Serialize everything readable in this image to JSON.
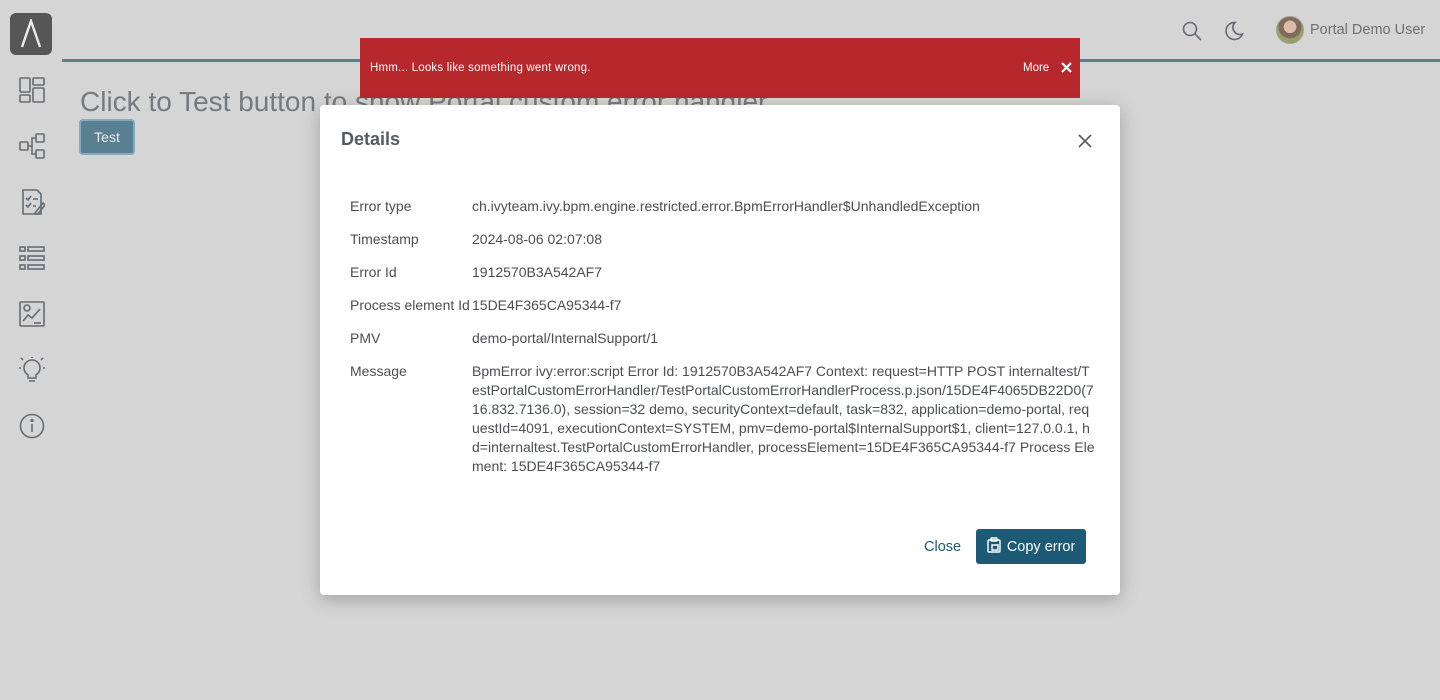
{
  "sidebar": {
    "logo_icon": "axon-ivy-logo-icon",
    "items": [
      {
        "icon": "dashboard-icon"
      },
      {
        "icon": "process-icon"
      },
      {
        "icon": "task-list-icon"
      },
      {
        "icon": "case-list-icon"
      },
      {
        "icon": "statistics-icon"
      },
      {
        "icon": "lightbulb-icon"
      },
      {
        "icon": "info-icon"
      }
    ]
  },
  "header": {
    "search_icon": "search-icon",
    "theme_icon": "moon-icon",
    "user_name": "Portal Demo User"
  },
  "main": {
    "title": "Click to Test button to show Portal custom error handler",
    "test_button": "Test"
  },
  "growl": {
    "message": "Hmm... Looks like something went wrong.",
    "more_label": "More"
  },
  "dialog": {
    "title": "Details",
    "fields": [
      {
        "label": "Error type",
        "value": "ch.ivyteam.ivy.bpm.engine.restricted.error.BpmErrorHandler$UnhandledException"
      },
      {
        "label": "Timestamp",
        "value": "2024-08-06 02:07:08"
      },
      {
        "label": "Error Id",
        "value": "1912570B3A542AF7"
      },
      {
        "label": "Process element Id",
        "value": "15DE4F365CA95344-f7"
      },
      {
        "label": "PMV",
        "value": "demo-portal/InternalSupport/1"
      },
      {
        "label": "Message",
        "value": "BpmError ivy:error:script Error Id: 1912570B3A542AF7 Context: request=HTTP POST internaltest/TestPortalCustomErrorHandler/TestPortalCustomErrorHandlerProcess.p.json/15DE4F4065DB22D0(716.832.7136.0), session=32 demo, securityContext=default, task=832, application=demo-portal, requestId=4091, executionContext=SYSTEM, pmv=demo-portal$InternalSupport$1, client=127.0.0.1, hd=internaltest.TestPortalCustomErrorHandler, processElement=15DE4F365CA95344-f7 Process Element: 15DE4F365CA95344-f7"
      }
    ],
    "close_label": "Close",
    "copy_label": "Copy error"
  },
  "colors": {
    "primary": "#1d5a75",
    "error": "#b7282d",
    "background": "#dcdcdc"
  }
}
